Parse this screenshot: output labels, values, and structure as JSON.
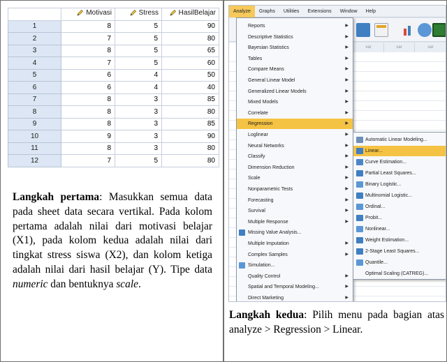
{
  "left": {
    "columns": [
      "Motivasi",
      "Stress",
      "HasilBelajar"
    ],
    "rows": [
      {
        "n": "1",
        "motivasi": "8",
        "stress": "5",
        "hasil": "90"
      },
      {
        "n": "2",
        "motivasi": "7",
        "stress": "5",
        "hasil": "80"
      },
      {
        "n": "3",
        "motivasi": "8",
        "stress": "5",
        "hasil": "65"
      },
      {
        "n": "4",
        "motivasi": "7",
        "stress": "5",
        "hasil": "60"
      },
      {
        "n": "5",
        "motivasi": "6",
        "stress": "4",
        "hasil": "50"
      },
      {
        "n": "6",
        "motivasi": "6",
        "stress": "4",
        "hasil": "40"
      },
      {
        "n": "7",
        "motivasi": "8",
        "stress": "3",
        "hasil": "85"
      },
      {
        "n": "8",
        "motivasi": "8",
        "stress": "3",
        "hasil": "80"
      },
      {
        "n": "9",
        "motivasi": "8",
        "stress": "3",
        "hasil": "85"
      },
      {
        "n": "10",
        "motivasi": "9",
        "stress": "3",
        "hasil": "90"
      },
      {
        "n": "11",
        "motivasi": "8",
        "stress": "3",
        "hasil": "80"
      },
      {
        "n": "12",
        "motivasi": "7",
        "stress": "5",
        "hasil": "80"
      }
    ],
    "caption_bold": "Langkah pertama",
    "caption_text_1": ": Masukkan semua data pada sheet data secara vertikal. Pada kolom pertama adalah nilai dari motivasi belajar (X1), pada kolom kedua adalah nilai dari tingkat stress siswa (X2), dan kolom ketiga adalah nilai dari hasil belajar (Y). Tipe data ",
    "caption_italic_1": "numeric",
    "caption_text_2": " dan bentuknya ",
    "caption_italic_2": "scale",
    "caption_text_3": "."
  },
  "right": {
    "menubar": [
      "Analyze",
      "Graphs",
      "Utilities",
      "Extensions",
      "Window",
      "Help"
    ],
    "menu_items": [
      {
        "label": "Reports",
        "arrow": true
      },
      {
        "label": "Descriptive Statistics",
        "arrow": true
      },
      {
        "label": "Bayesian Statistics",
        "arrow": true
      },
      {
        "label": "Tables",
        "arrow": true
      },
      {
        "label": "Compare Means",
        "arrow": true
      },
      {
        "label": "General Linear Model",
        "arrow": true
      },
      {
        "label": "Generalized Linear Models",
        "arrow": true
      },
      {
        "label": "Mixed Models",
        "arrow": true
      },
      {
        "label": "Correlate",
        "arrow": true
      },
      {
        "label": "Regression",
        "arrow": true
      },
      {
        "label": "Loglinear",
        "arrow": true
      },
      {
        "label": "Neural Networks",
        "arrow": true
      },
      {
        "label": "Classify",
        "arrow": true
      },
      {
        "label": "Dimension Reduction",
        "arrow": true
      },
      {
        "label": "Scale",
        "arrow": true
      },
      {
        "label": "Nonparametric Tests",
        "arrow": true
      },
      {
        "label": "Forecasting",
        "arrow": true
      },
      {
        "label": "Survival",
        "arrow": true
      },
      {
        "label": "Multiple Response",
        "arrow": true
      },
      {
        "label": "Missing Value Analysis...",
        "arrow": false
      },
      {
        "label": "Multiple Imputation",
        "arrow": true
      },
      {
        "label": "Complex Samples",
        "arrow": true
      },
      {
        "label": "Simulation...",
        "arrow": false
      },
      {
        "label": "Quality Control",
        "arrow": true
      },
      {
        "label": "Spatial and Temporal Modeling...",
        "arrow": true
      },
      {
        "label": "Direct Marketing",
        "arrow": true
      }
    ],
    "submenu_items": [
      {
        "label": "Automatic Linear Modeling..."
      },
      {
        "label": "Linear..."
      },
      {
        "label": "Curve Estimation..."
      },
      {
        "label": "Partial Least Squares..."
      },
      {
        "label": "Binary Logistic..."
      },
      {
        "label": "Multinomial Logistic..."
      },
      {
        "label": "Ordinal..."
      },
      {
        "label": "Probit..."
      },
      {
        "label": "Nonlinear..."
      },
      {
        "label": "Weight Estimation..."
      },
      {
        "label": "2-Stage Least Squares..."
      },
      {
        "label": "Quantile..."
      },
      {
        "label": "Optimal Scaling (CATREG)..."
      }
    ],
    "caption_bold": "Langkah kedua",
    "caption_text": ": Pilih menu pada bagian atas analyze > Regression > Linear."
  },
  "colors": {
    "highlight": "#f5c343",
    "rownum_bg": "#dce6f4",
    "grid_line": "#c6cfdc"
  }
}
